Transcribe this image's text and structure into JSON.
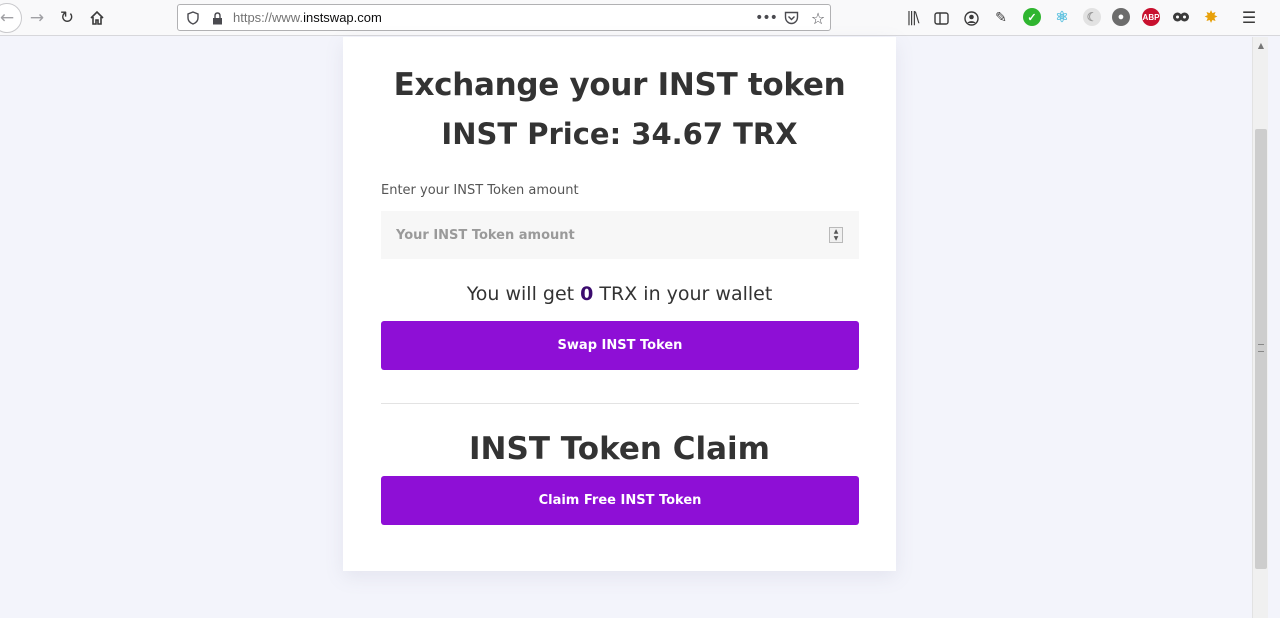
{
  "browser": {
    "url_scheme": "https://www.",
    "url_host": "instswap.com",
    "icons": {
      "back": "arrow-left-icon",
      "forward": "arrow-right-icon",
      "reload": "reload-icon",
      "home": "home-icon",
      "tracking_shield": "shield-icon",
      "lock": "lock-icon",
      "page_actions": "ellipsis-icon",
      "pocket": "pocket-icon",
      "bookmark": "star-icon",
      "library": "library-icon",
      "sidebar": "sidebar-icon",
      "account": "account-icon",
      "menu": "hamburger-menu-icon"
    },
    "extensions": {
      "abp_label": "ABP"
    }
  },
  "exchange": {
    "title": "Exchange your INST token",
    "price_text": "INST Price: 34.67 TRX",
    "amount_label": "Enter your INST Token amount",
    "amount_placeholder": "Your INST Token amount",
    "amount_value": "",
    "result_prefix": "You will get",
    "result_value": "0",
    "result_suffix": "TRX in your wallet",
    "swap_button": "Swap INST Token"
  },
  "claim": {
    "title": "INST Token Claim",
    "claim_button": "Claim Free INST Token"
  },
  "colors": {
    "accent": "#8e0fd6",
    "result_value": "#3b0b6e",
    "heading": "#333333",
    "page_background": "#f3f4fb"
  }
}
